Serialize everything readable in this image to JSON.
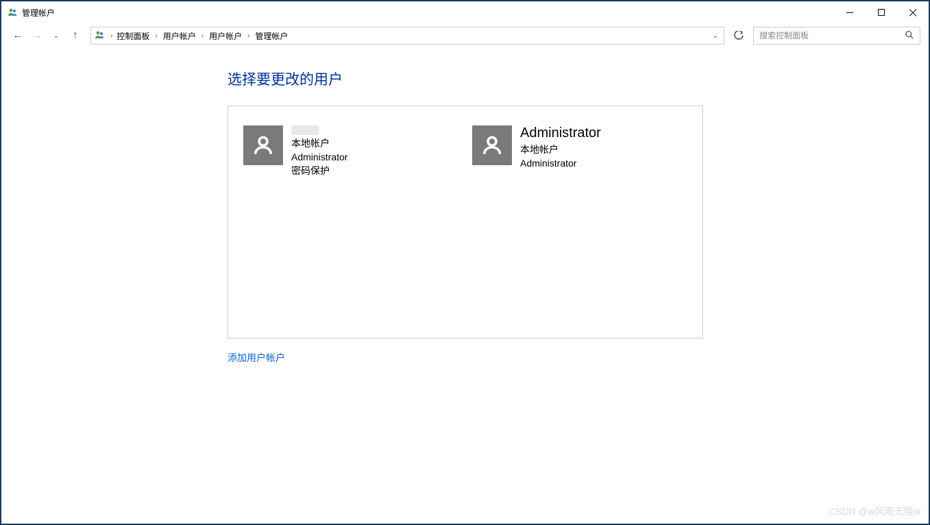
{
  "window": {
    "title": "管理帐户"
  },
  "breadcrumb": {
    "items": [
      "控制面板",
      "用户帐户",
      "用户帐户",
      "管理帐户"
    ]
  },
  "search": {
    "placeholder": "搜索控制面板"
  },
  "page": {
    "title": "选择要更改的用户"
  },
  "users": [
    {
      "name_obscured": true,
      "name": "",
      "line1": "本地帐户",
      "line2": "Administrator",
      "line3": "密码保护"
    },
    {
      "name_obscured": false,
      "name": "Administrator",
      "line1": "本地帐户",
      "line2": "Administrator",
      "line3": ""
    }
  ],
  "links": {
    "add_account": "添加用户帐户"
  },
  "watermark": "CSDN @w风雨无阻w"
}
